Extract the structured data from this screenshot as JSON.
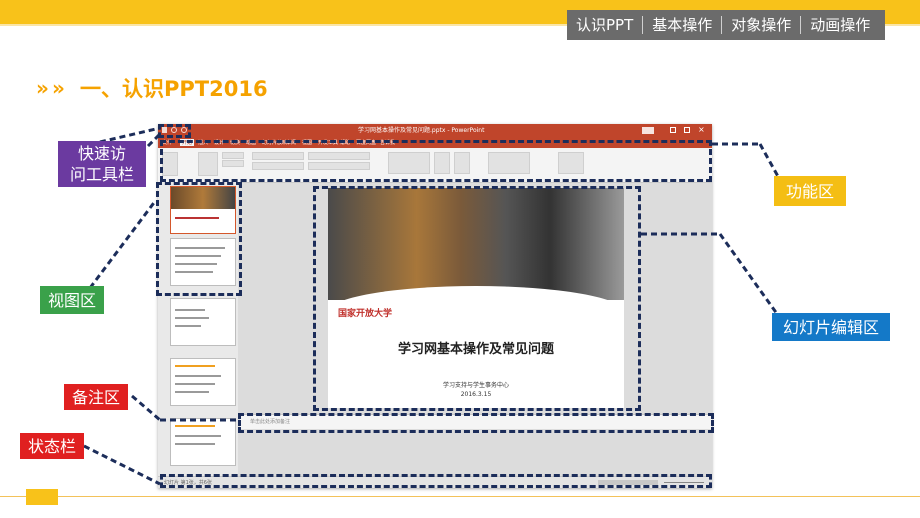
{
  "nav": {
    "items": [
      "认识PPT",
      "基本操作",
      "对象操作",
      "动画操作"
    ]
  },
  "heading": {
    "chevrons": "»",
    "title": "一、认识PPT2016"
  },
  "screenshot": {
    "window_title": "学习网基本操作及常见问题.pptx - PowerPoint",
    "ribbon_tabs": [
      "文件",
      "开始",
      "插入",
      "设计",
      "切换",
      "动画",
      "幻灯片放映",
      "审阅",
      "视图",
      "开发工具",
      "帮助",
      "百度网盘",
      "告诉我"
    ],
    "slide": {
      "logo_text": "国家开放大学",
      "title": "学习网基本操作及常见问题",
      "subtitle": "学习支持与学生事务中心",
      "date": "2016.3.15"
    },
    "notes_placeholder": "单击此处添加备注",
    "status_text": "幻灯片 第1张，共6张"
  },
  "labels": {
    "quick_access": "快速访\n问工具栏",
    "ribbon": "功能区",
    "view_area": "视图区",
    "slide_edit": "幻灯片编辑区",
    "notes_area": "备注区",
    "status_bar": "状态栏"
  },
  "colors": {
    "accent": "#f8c21a",
    "dash": "#1c2d5a",
    "label_purple": "#6b3aa0",
    "label_yellow": "#f4be14",
    "label_green": "#3aa14a",
    "label_blue": "#1479c8",
    "label_red": "#e02020",
    "ppt_red": "#c0452b"
  }
}
